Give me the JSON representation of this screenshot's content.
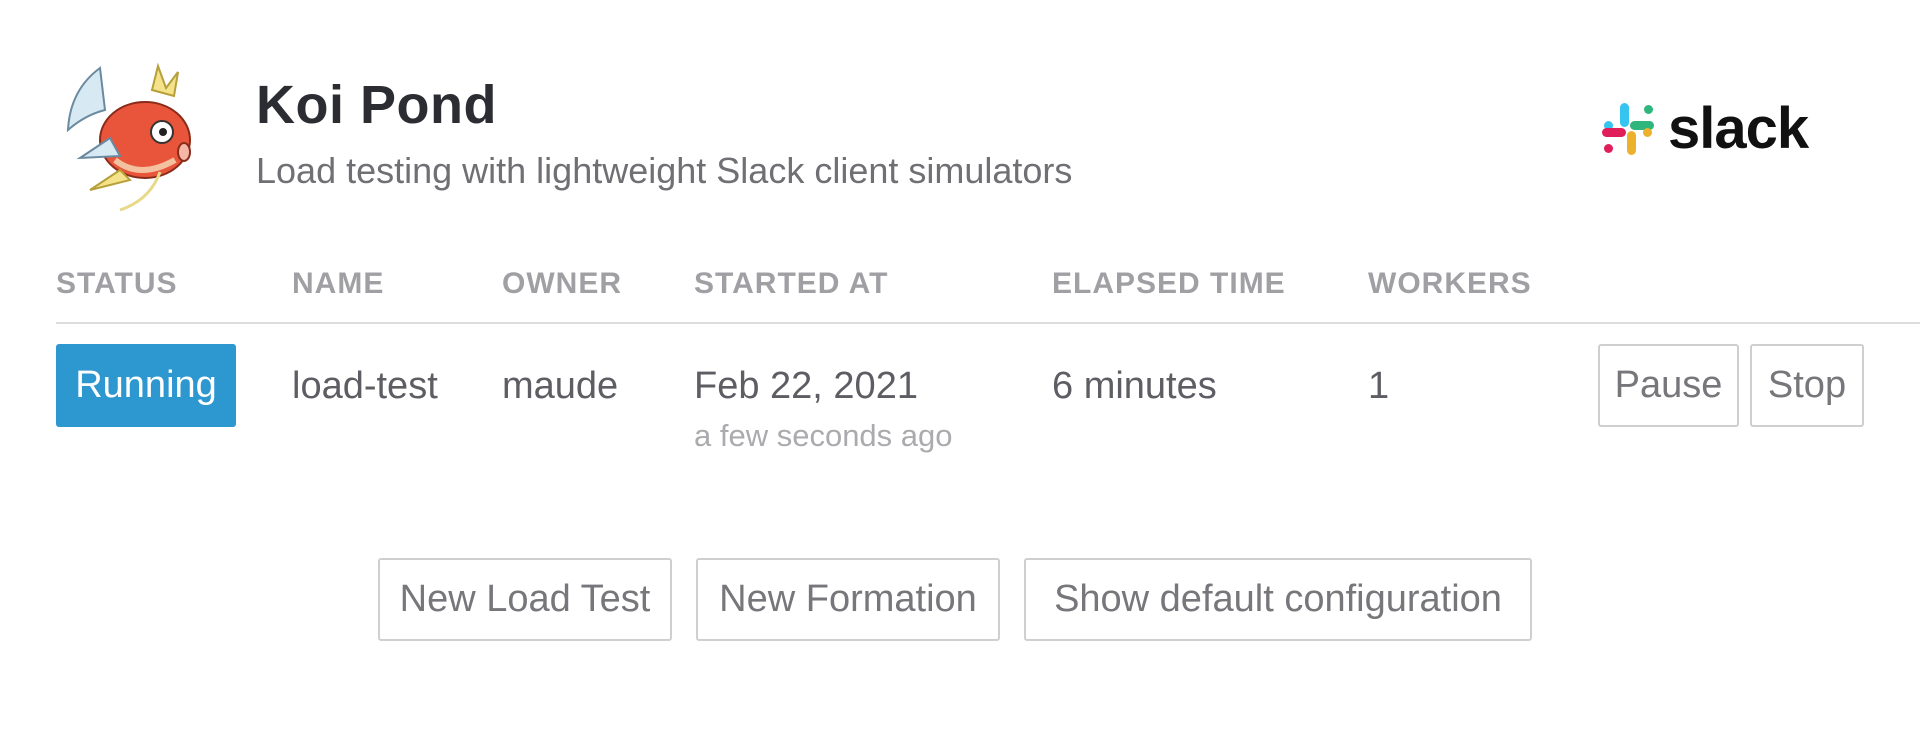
{
  "header": {
    "title": "Koi Pond",
    "subtitle": "Load testing with lightweight Slack client simulators",
    "brand_name": "slack",
    "logo_icon": "magikarp-fish-icon",
    "brand_icon": "slack-hash-icon"
  },
  "table": {
    "headers": {
      "status": "STATUS",
      "name": "NAME",
      "owner": "OWNER",
      "started_at": "STARTED AT",
      "elapsed_time": "ELAPSED TIME",
      "workers": "WORKERS"
    },
    "rows": [
      {
        "status": "Running",
        "name": "load-test",
        "owner": "maude",
        "started_at": "Feb 22, 2021",
        "started_relative": "a few seconds ago",
        "elapsed_time": "6 minutes",
        "workers": "1",
        "actions": {
          "pause": "Pause",
          "stop": "Stop"
        }
      }
    ]
  },
  "actions": {
    "new_load_test": "New Load Test",
    "new_formation": "New Formation",
    "show_default_configuration": "Show default configuration"
  },
  "colors": {
    "status_running": "#2d98d0",
    "title": "#2c2d33",
    "header_text": "#a0a0a4",
    "slack_blue": "#36c5f0",
    "slack_green": "#2eb67d",
    "slack_yellow": "#ecb22e",
    "slack_red": "#e01e5a"
  }
}
